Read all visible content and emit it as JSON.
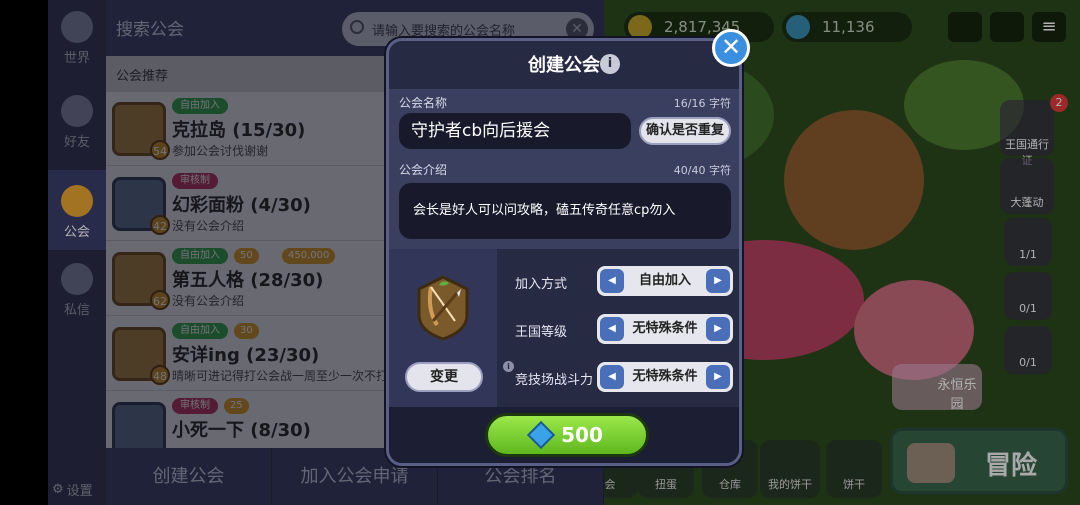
{
  "sidebar": {
    "items": [
      {
        "label": "世界"
      },
      {
        "label": "好友"
      },
      {
        "label": "公会"
      },
      {
        "label": "私信"
      }
    ],
    "settings_label": "设置"
  },
  "guild_panel": {
    "title": "搜索公会",
    "search_placeholder": "请输入要搜索的公会名称",
    "recommend_label": "公会推荐",
    "guilds": [
      {
        "tag": "自由加入",
        "name": "克拉岛 (15/30)",
        "desc": "参加公会讨伐谢谢",
        "level": "54",
        "chips": []
      },
      {
        "tag": "审核制",
        "name": "幻彩面粉 (4/30)",
        "desc": "没有公会介绍",
        "level": "42",
        "chips": []
      },
      {
        "tag": "自由加入",
        "name": "第五人格 (28/30)",
        "desc": "没有公会介绍",
        "level": "62",
        "chips": [
          "50",
          "450,000"
        ]
      },
      {
        "tag": "自由加入",
        "name": "安详ing (23/30)",
        "desc": "晴晰可进记得打公会战一周至少一次不打会",
        "level": "48",
        "chips": [
          "30"
        ]
      },
      {
        "tag": "审核制",
        "name": "小死一下 (8/30)",
        "desc": "",
        "level": "",
        "chips": [
          "25"
        ]
      }
    ],
    "bottom_tabs": [
      "创建公会",
      "加入公会申请",
      "公会排名"
    ]
  },
  "world": {
    "coins": "2,817,345",
    "gems": "11,136",
    "kingdom_pass_label": "王国通行证",
    "kingdom_pass_badge": "2",
    "event_label": "大蓬动",
    "side_counts": [
      "1/1",
      "0/1",
      "0/1"
    ],
    "eternal_label": "永恒乐园",
    "bottom_labels": [
      "会",
      "扭蛋",
      "仓库",
      "我的饼干",
      "饼干"
    ],
    "adventure_label": "冒险"
  },
  "modal": {
    "title": "创建公会",
    "name_label": "公会名称",
    "name_count": "16/16 字符",
    "name_value": "守护者cb向后援会",
    "check_dup_label": "确认是否重复",
    "intro_label": "公会介绍",
    "intro_count": "40/40 字符",
    "intro_value": "会长是好人可以问攻略，磕五传奇任意cp勿入",
    "change_label": "变更",
    "settings": [
      {
        "label": "加入方式",
        "value": "自由加入"
      },
      {
        "label": "王国等级",
        "value": "无特殊条件"
      },
      {
        "label": "竞技场战斗力",
        "value": "无特殊条件"
      }
    ],
    "create_cost": "500",
    "close_icon": "close-icon",
    "info_icon": "info-icon"
  }
}
